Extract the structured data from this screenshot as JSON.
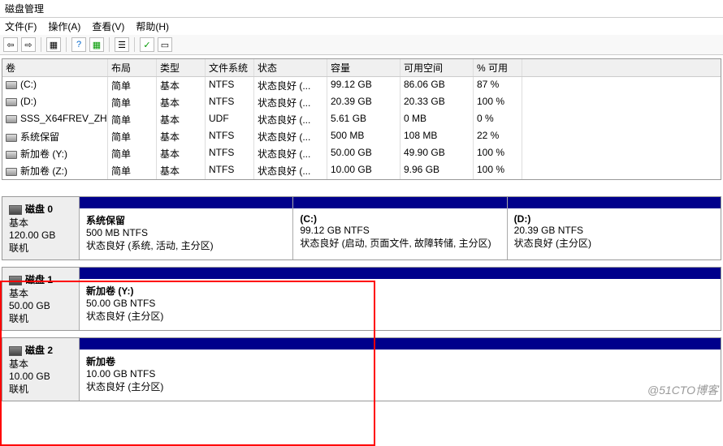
{
  "window": {
    "title": "磁盘管理"
  },
  "menu": {
    "file": "文件(F)",
    "action": "操作(A)",
    "view": "查看(V)",
    "help": "帮助(H)"
  },
  "toolbar": {
    "back": "⇦",
    "forward": "⇨",
    "sep1": "|",
    "grid1": "▦",
    "sep2": "|",
    "help": "?",
    "refresh": "▦",
    "sep3": "|",
    "list": "☰",
    "sep4": "|",
    "check": "✓",
    "props": "▭"
  },
  "volHeaders": {
    "vol": "卷",
    "layout": "布局",
    "type": "类型",
    "fs": "文件系统",
    "status": "状态",
    "cap": "容量",
    "free": "可用空间",
    "pct": "% 可用"
  },
  "volumes": [
    {
      "name": "(C:)",
      "layout": "简单",
      "type": "基本",
      "fs": "NTFS",
      "status": "状态良好 (...",
      "cap": "99.12 GB",
      "free": "86.06 GB",
      "pct": "87 %"
    },
    {
      "name": "(D:)",
      "layout": "简单",
      "type": "基本",
      "fs": "NTFS",
      "status": "状态良好 (...",
      "cap": "20.39 GB",
      "free": "20.33 GB",
      "pct": "100 %"
    },
    {
      "name": "SSS_X64FREV_ZH...",
      "layout": "简单",
      "type": "基本",
      "fs": "UDF",
      "status": "状态良好 (...",
      "cap": "5.61 GB",
      "free": "0 MB",
      "pct": "0 %"
    },
    {
      "name": "系统保留",
      "layout": "简单",
      "type": "基本",
      "fs": "NTFS",
      "status": "状态良好 (...",
      "cap": "500 MB",
      "free": "108 MB",
      "pct": "22 %"
    },
    {
      "name": "新加卷 (Y:)",
      "layout": "简单",
      "type": "基本",
      "fs": "NTFS",
      "status": "状态良好 (...",
      "cap": "50.00 GB",
      "free": "49.90 GB",
      "pct": "100 %"
    },
    {
      "name": "新加卷 (Z:)",
      "layout": "简单",
      "type": "基本",
      "fs": "NTFS",
      "status": "状态良好 (...",
      "cap": "10.00 GB",
      "free": "9.96 GB",
      "pct": "100 %"
    }
  ],
  "disks": [
    {
      "name": "磁盘 0",
      "kind": "基本",
      "size": "120.00 GB",
      "state": "联机",
      "parts": [
        {
          "name": "系统保留",
          "size": "500 MB NTFS",
          "status": "状态良好 (系统, 活动, 主分区)"
        },
        {
          "name": "(C:)",
          "size": "99.12 GB NTFS",
          "status": "状态良好 (启动, 页面文件, 故障转储, 主分区)"
        },
        {
          "name": "(D:)",
          "size": "20.39 GB NTFS",
          "status": "状态良好 (主分区)"
        }
      ]
    },
    {
      "name": "磁盘 1",
      "kind": "基本",
      "size": "50.00 GB",
      "state": "联机",
      "parts": [
        {
          "name": "新加卷  (Y:)",
          "size": "50.00 GB NTFS",
          "status": "状态良好 (主分区)"
        }
      ]
    },
    {
      "name": "磁盘 2",
      "kind": "基本",
      "size": "10.00 GB",
      "state": "联机",
      "parts": [
        {
          "name": "新加卷",
          "size": "10.00 GB NTFS",
          "status": "状态良好 (主分区)"
        }
      ]
    }
  ],
  "watermark": "@51CTO博客"
}
